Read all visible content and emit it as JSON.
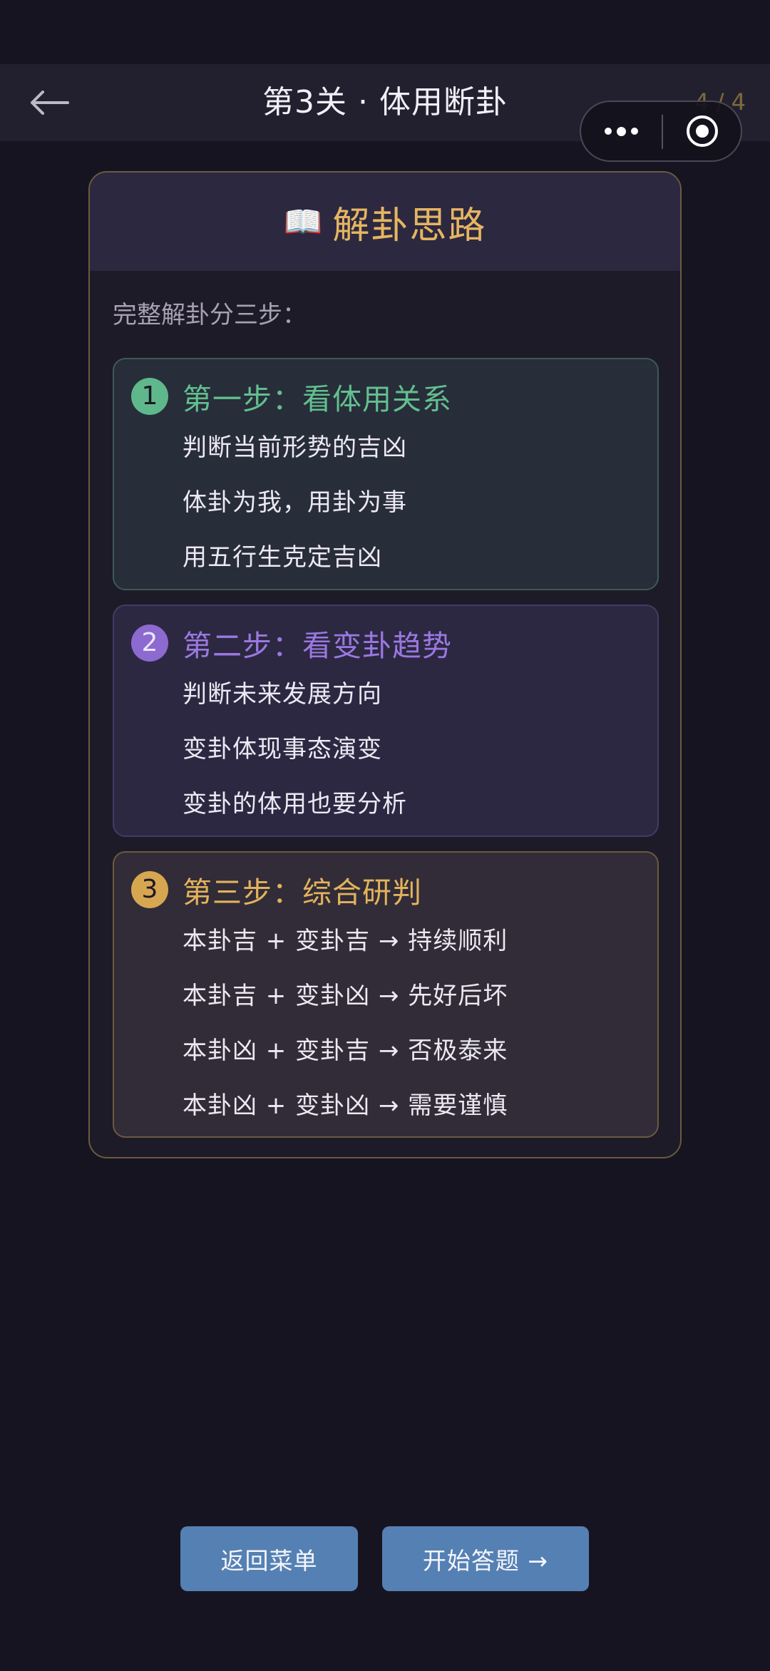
{
  "header": {
    "title": "第3关 · 体用断卦",
    "progress": "4 / 4",
    "back_icon": "arrow-left-icon"
  },
  "card": {
    "icon": "📖",
    "title": "解卦思路",
    "intro": "完整解卦分三步："
  },
  "steps": [
    {
      "number": "1",
      "title": "第一步：看体用关系",
      "color": "#62c08f",
      "lines": [
        "判断当前形势的吉凶",
        "体卦为我，用卦为事",
        "用五行生克定吉凶"
      ]
    },
    {
      "number": "2",
      "title": "第二步：看变卦趋势",
      "color": "#9b78e0",
      "lines": [
        "判断未来发展方向",
        "变卦体现事态演变",
        "变卦的体用也要分析"
      ]
    },
    {
      "number": "3",
      "title": "第三步：综合研判",
      "color": "#e3b25c",
      "lines": [
        "本卦吉 + 变卦吉 → 持续顺利",
        "本卦吉 + 变卦凶 → 先好后坏",
        "本卦凶 + 变卦吉 → 否极泰来",
        "本卦凶 + 变卦凶 → 需要谨慎"
      ]
    }
  ],
  "buttons": {
    "menu": "返回菜单",
    "start": "开始答题 →"
  },
  "colors": {
    "background": "#171421",
    "accent_gold": "#e6b562",
    "button": "#5580b3"
  }
}
